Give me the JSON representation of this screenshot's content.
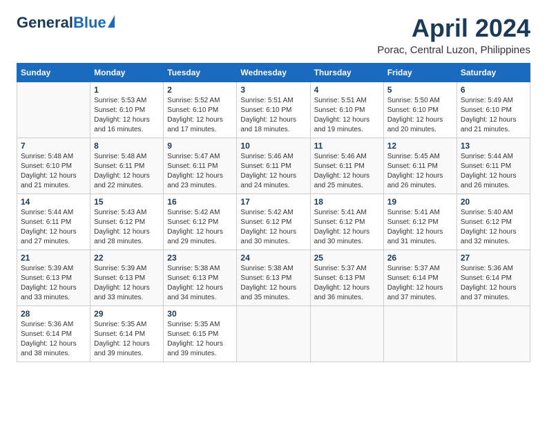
{
  "header": {
    "logo_general": "General",
    "logo_blue": "Blue",
    "month_title": "April 2024",
    "location": "Porac, Central Luzon, Philippines"
  },
  "weekdays": [
    "Sunday",
    "Monday",
    "Tuesday",
    "Wednesday",
    "Thursday",
    "Friday",
    "Saturday"
  ],
  "weeks": [
    [
      {
        "day": "",
        "info": ""
      },
      {
        "day": "1",
        "info": "Sunrise: 5:53 AM\nSunset: 6:10 PM\nDaylight: 12 hours\nand 16 minutes."
      },
      {
        "day": "2",
        "info": "Sunrise: 5:52 AM\nSunset: 6:10 PM\nDaylight: 12 hours\nand 17 minutes."
      },
      {
        "day": "3",
        "info": "Sunrise: 5:51 AM\nSunset: 6:10 PM\nDaylight: 12 hours\nand 18 minutes."
      },
      {
        "day": "4",
        "info": "Sunrise: 5:51 AM\nSunset: 6:10 PM\nDaylight: 12 hours\nand 19 minutes."
      },
      {
        "day": "5",
        "info": "Sunrise: 5:50 AM\nSunset: 6:10 PM\nDaylight: 12 hours\nand 20 minutes."
      },
      {
        "day": "6",
        "info": "Sunrise: 5:49 AM\nSunset: 6:10 PM\nDaylight: 12 hours\nand 21 minutes."
      }
    ],
    [
      {
        "day": "7",
        "info": "Sunrise: 5:48 AM\nSunset: 6:10 PM\nDaylight: 12 hours\nand 21 minutes."
      },
      {
        "day": "8",
        "info": "Sunrise: 5:48 AM\nSunset: 6:11 PM\nDaylight: 12 hours\nand 22 minutes."
      },
      {
        "day": "9",
        "info": "Sunrise: 5:47 AM\nSunset: 6:11 PM\nDaylight: 12 hours\nand 23 minutes."
      },
      {
        "day": "10",
        "info": "Sunrise: 5:46 AM\nSunset: 6:11 PM\nDaylight: 12 hours\nand 24 minutes."
      },
      {
        "day": "11",
        "info": "Sunrise: 5:46 AM\nSunset: 6:11 PM\nDaylight: 12 hours\nand 25 minutes."
      },
      {
        "day": "12",
        "info": "Sunrise: 5:45 AM\nSunset: 6:11 PM\nDaylight: 12 hours\nand 26 minutes."
      },
      {
        "day": "13",
        "info": "Sunrise: 5:44 AM\nSunset: 6:11 PM\nDaylight: 12 hours\nand 26 minutes."
      }
    ],
    [
      {
        "day": "14",
        "info": "Sunrise: 5:44 AM\nSunset: 6:11 PM\nDaylight: 12 hours\nand 27 minutes."
      },
      {
        "day": "15",
        "info": "Sunrise: 5:43 AM\nSunset: 6:12 PM\nDaylight: 12 hours\nand 28 minutes."
      },
      {
        "day": "16",
        "info": "Sunrise: 5:42 AM\nSunset: 6:12 PM\nDaylight: 12 hours\nand 29 minutes."
      },
      {
        "day": "17",
        "info": "Sunrise: 5:42 AM\nSunset: 6:12 PM\nDaylight: 12 hours\nand 30 minutes."
      },
      {
        "day": "18",
        "info": "Sunrise: 5:41 AM\nSunset: 6:12 PM\nDaylight: 12 hours\nand 30 minutes."
      },
      {
        "day": "19",
        "info": "Sunrise: 5:41 AM\nSunset: 6:12 PM\nDaylight: 12 hours\nand 31 minutes."
      },
      {
        "day": "20",
        "info": "Sunrise: 5:40 AM\nSunset: 6:12 PM\nDaylight: 12 hours\nand 32 minutes."
      }
    ],
    [
      {
        "day": "21",
        "info": "Sunrise: 5:39 AM\nSunset: 6:13 PM\nDaylight: 12 hours\nand 33 minutes."
      },
      {
        "day": "22",
        "info": "Sunrise: 5:39 AM\nSunset: 6:13 PM\nDaylight: 12 hours\nand 33 minutes."
      },
      {
        "day": "23",
        "info": "Sunrise: 5:38 AM\nSunset: 6:13 PM\nDaylight: 12 hours\nand 34 minutes."
      },
      {
        "day": "24",
        "info": "Sunrise: 5:38 AM\nSunset: 6:13 PM\nDaylight: 12 hours\nand 35 minutes."
      },
      {
        "day": "25",
        "info": "Sunrise: 5:37 AM\nSunset: 6:13 PM\nDaylight: 12 hours\nand 36 minutes."
      },
      {
        "day": "26",
        "info": "Sunrise: 5:37 AM\nSunset: 6:14 PM\nDaylight: 12 hours\nand 37 minutes."
      },
      {
        "day": "27",
        "info": "Sunrise: 5:36 AM\nSunset: 6:14 PM\nDaylight: 12 hours\nand 37 minutes."
      }
    ],
    [
      {
        "day": "28",
        "info": "Sunrise: 5:36 AM\nSunset: 6:14 PM\nDaylight: 12 hours\nand 38 minutes."
      },
      {
        "day": "29",
        "info": "Sunrise: 5:35 AM\nSunset: 6:14 PM\nDaylight: 12 hours\nand 39 minutes."
      },
      {
        "day": "30",
        "info": "Sunrise: 5:35 AM\nSunset: 6:15 PM\nDaylight: 12 hours\nand 39 minutes."
      },
      {
        "day": "",
        "info": ""
      },
      {
        "day": "",
        "info": ""
      },
      {
        "day": "",
        "info": ""
      },
      {
        "day": "",
        "info": ""
      }
    ]
  ]
}
